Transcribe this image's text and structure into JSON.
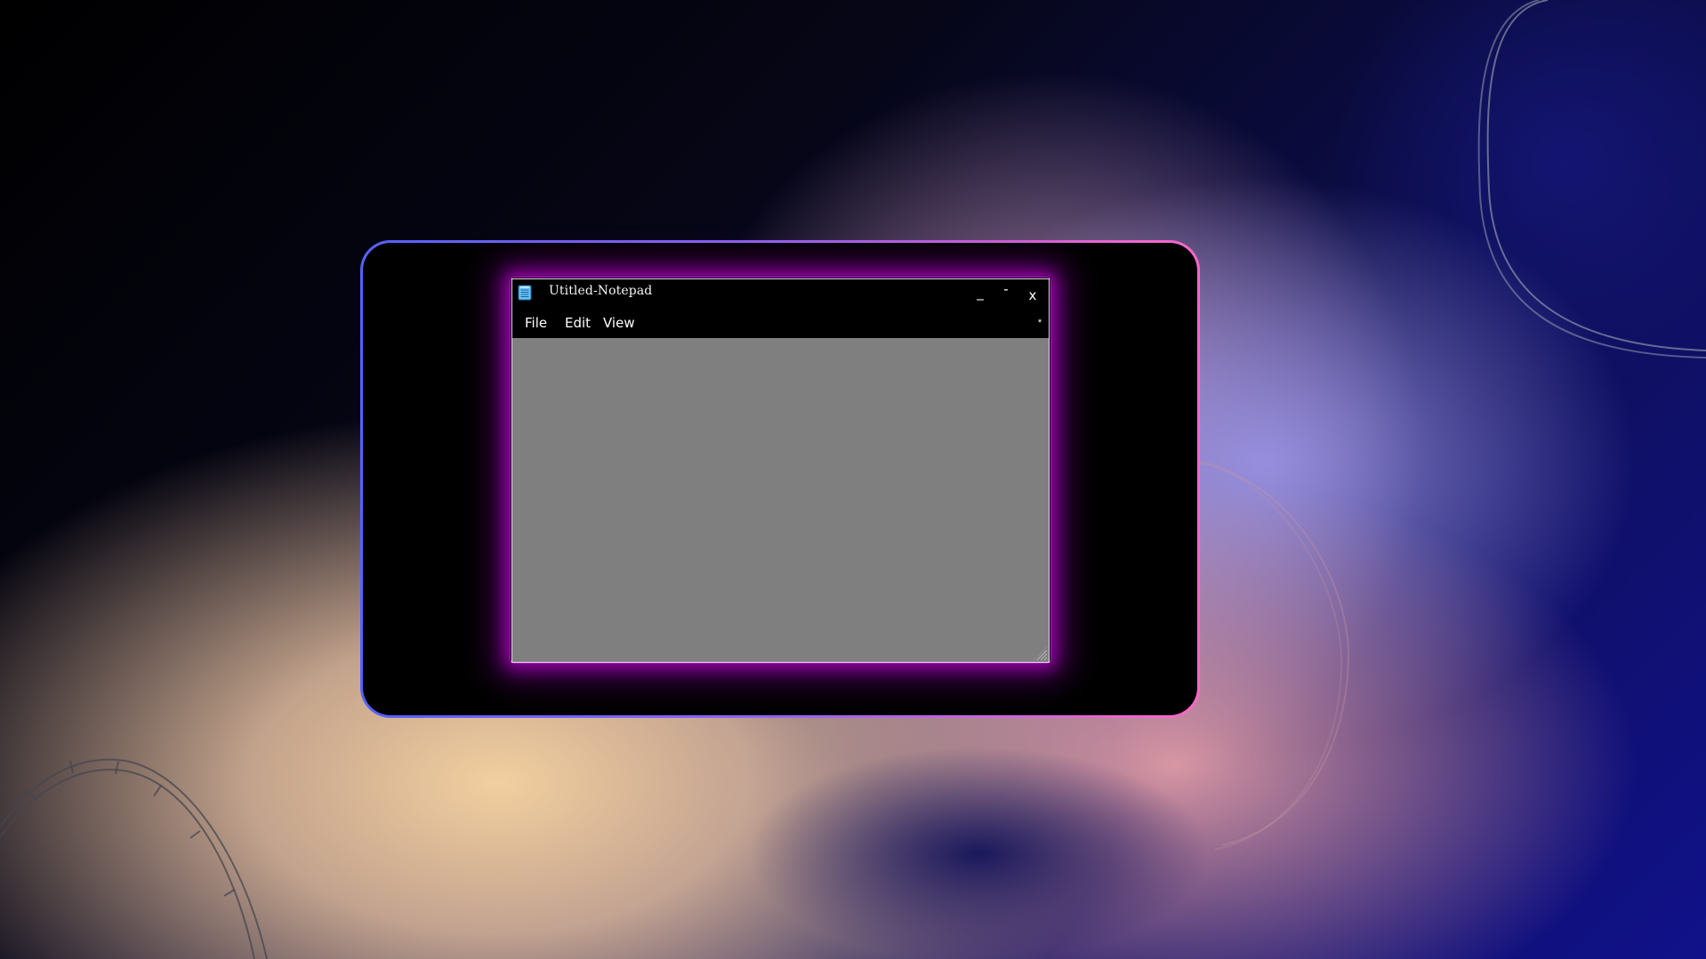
{
  "window": {
    "title": "Utitled-Notepad"
  },
  "icons": {
    "app_icon": "notepad-icon",
    "minimize": "minimize-icon",
    "maximize": "maximize-icon",
    "close": "close-icon",
    "extra": "asterisk-icon",
    "resize": "resize-grip-icon"
  },
  "controls": {
    "minimize": "_",
    "maximize": "-",
    "close": "x",
    "extra": "*"
  },
  "menu": {
    "items": [
      {
        "label": "File"
      },
      {
        "label": "Edit"
      },
      {
        "label": "View"
      }
    ]
  },
  "editor": {
    "value": ""
  },
  "colors": {
    "window_bg": "#7f7f7f",
    "titlebar_bg": "#000000",
    "glow": "#b100c4",
    "frame_start": "#5661ff",
    "frame_end": "#ff66c8"
  }
}
